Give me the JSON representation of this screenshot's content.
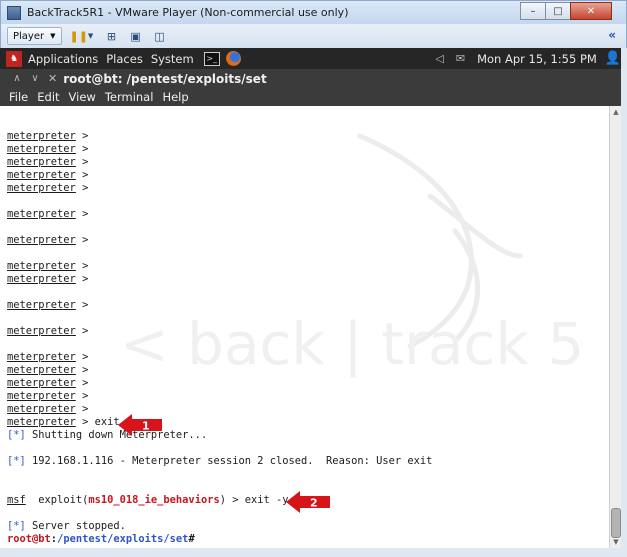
{
  "vmware": {
    "title": "BackTrack5R1 - VMware Player (Non-commercial use only)",
    "player_menu": "Player",
    "fullscreen_arrows": "«",
    "controls": {
      "minimize": "–",
      "maximize": "□",
      "close": "✕"
    }
  },
  "panel": {
    "menus": [
      "Applications",
      "Places",
      "System"
    ],
    "clock": "Mon Apr 15,  1:55 PM"
  },
  "terminal": {
    "window_title": "root@bt: /pentest/exploits/set",
    "menus": [
      "File",
      "Edit",
      "View",
      "Terminal",
      "Help"
    ],
    "prompt_word": "meterpreter",
    "prompt_suffix": " >",
    "exit_cmd": " > exit",
    "shutting_star": "[*]",
    "shutting_text": " Shutting down Meterpreter...",
    "closed_star": "[*]",
    "closed_text": " 192.168.1.116 - Meterpreter session 2 closed.  Reason: User exit",
    "msf_word": "msf",
    "msf_exploit": "  exploit(",
    "msf_module": "ms10_018_ie_behaviors",
    "msf_cmd": ") > exit -y",
    "stopped_star": "[*]",
    "stopped_text": " Server stopped.",
    "final_user": "root@bt",
    "final_colon": ":",
    "final_path": "/pentest/exploits/set",
    "final_hash": "#"
  },
  "annotations": {
    "marker_1": "1",
    "marker_2": "2",
    "marker_color": "#d8141b"
  },
  "watermark_text": "< back | track 5"
}
